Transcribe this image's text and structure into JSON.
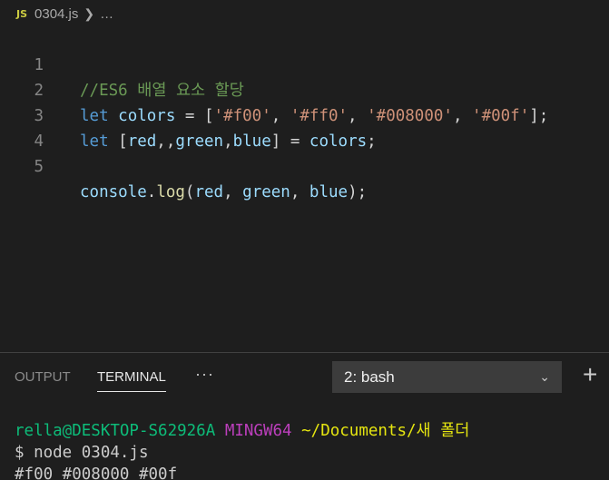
{
  "breadcrumb": {
    "file_icon": "JS",
    "file_name": "0304.js",
    "more": "…"
  },
  "editor": {
    "lines": [
      {
        "number": "1"
      },
      {
        "number": "2"
      },
      {
        "number": "3"
      },
      {
        "number": "4"
      },
      {
        "number": "5"
      }
    ],
    "code": {
      "l1_comment": "//ES6 배열 요소 할당",
      "l2_let": "let",
      "l2_var": "colors",
      "l2_eq": " = [",
      "l2_s1": "'#f00'",
      "l2_c1": ", ",
      "l2_s2": "'#ff0'",
      "l2_c2": ", ",
      "l2_s3": "'#008000'",
      "l2_c3": ", ",
      "l2_s4": "'#00f'",
      "l2_end": "];",
      "l3_let": "let",
      "l3_open": " [",
      "l3_red": "red",
      "l3_commas": ",,",
      "l3_green": "green",
      "l3_comma": ",",
      "l3_blue": "blue",
      "l3_close": "] = ",
      "l3_colors": "colors",
      "l3_end": ";",
      "l5_console": "console",
      "l5_dot": ".",
      "l5_log": "log",
      "l5_open": "(",
      "l5_red": "red",
      "l5_c1": ", ",
      "l5_green": "green",
      "l5_c2": ", ",
      "l5_blue": "blue",
      "l5_end": ");"
    }
  },
  "panel": {
    "tabs": [
      {
        "label": "OUTPUT"
      },
      {
        "label": "TERMINAL"
      }
    ],
    "more": "···",
    "terminal_select": "2: bash",
    "add_label": "+"
  },
  "terminal": {
    "prompt_user": "rella@DESKTOP-S62926A",
    "prompt_env": "MINGW64",
    "prompt_path": "~/Documents/새 폴더",
    "command": "$ node 0304.js",
    "output": "#f00 #008000 #00f"
  },
  "colors": {
    "background": "#1e1e1e",
    "comment": "#6a9955",
    "keyword": "#569cd6",
    "variable": "#9cdcfe",
    "string": "#ce9178",
    "function": "#dcdcaa",
    "term_green": "#0dbc79",
    "term_magenta": "#bc3fbc",
    "term_yellow": "#e5e510"
  }
}
